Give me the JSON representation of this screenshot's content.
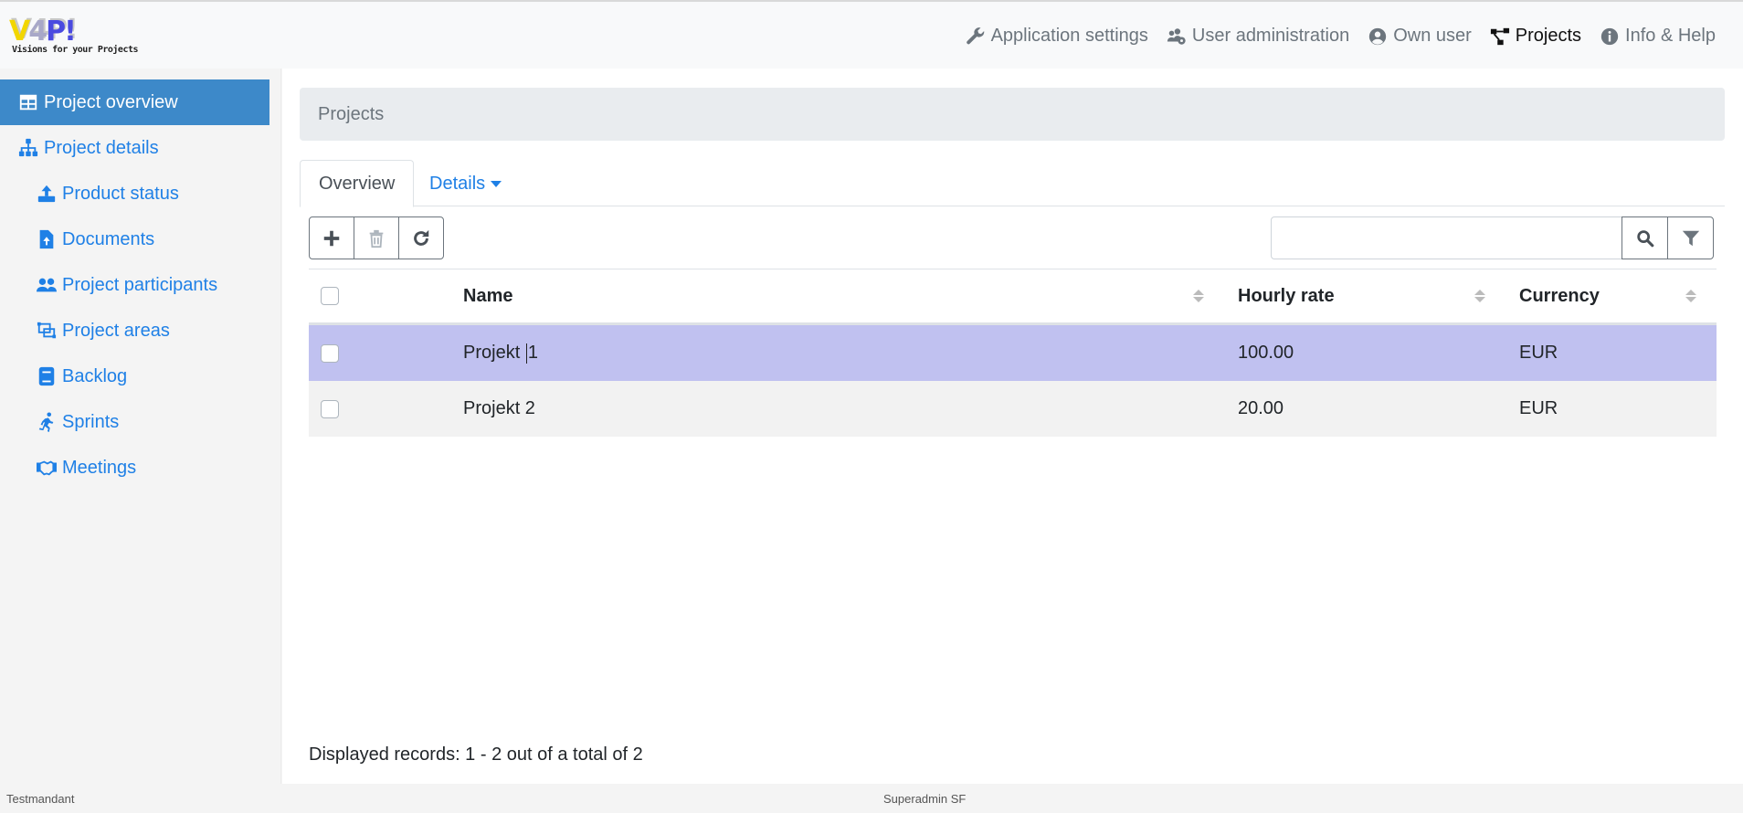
{
  "app": {
    "logo_text": "V4P!",
    "logo_parts": [
      "V",
      "4",
      "P!"
    ],
    "logo_tagline": "Visions for your Projects"
  },
  "topnav": [
    {
      "label": "Application settings",
      "icon": "wrench-icon",
      "active": false
    },
    {
      "label": "User administration",
      "icon": "users-cog-icon",
      "active": false
    },
    {
      "label": "Own user",
      "icon": "user-circle-icon",
      "active": false
    },
    {
      "label": "Projects",
      "icon": "project-diagram-icon",
      "active": true
    },
    {
      "label": "Info & Help",
      "icon": "info-circle-icon",
      "active": false
    }
  ],
  "sidebar": {
    "items": [
      {
        "label": "Project overview",
        "icon": "table-icon",
        "active": true
      },
      {
        "label": "Project details",
        "icon": "sitemap-icon",
        "active": false
      },
      {
        "label": "Product status",
        "icon": "upload-icon",
        "active": false
      },
      {
        "label": "Documents",
        "icon": "file-upload-icon",
        "active": false
      },
      {
        "label": "Project participants",
        "icon": "users-icon",
        "active": false
      },
      {
        "label": "Project areas",
        "icon": "object-group-icon",
        "active": false
      },
      {
        "label": "Backlog",
        "icon": "book-icon",
        "active": false
      },
      {
        "label": "Sprints",
        "icon": "running-icon",
        "active": false
      },
      {
        "label": "Meetings",
        "icon": "handshake-icon",
        "active": false
      }
    ]
  },
  "breadcrumb": {
    "title": "Projects"
  },
  "tabs": {
    "overview": "Overview",
    "details": "Details"
  },
  "toolbar": {
    "add": "add-icon",
    "delete": "trash-icon",
    "refresh": "refresh-icon"
  },
  "search": {
    "value": "",
    "placeholder": ""
  },
  "table": {
    "columns": [
      "Name",
      "Hourly rate",
      "Currency"
    ],
    "rows": [
      {
        "name_before_cursor": "Projekt ",
        "name_after_cursor": "1",
        "name": "Projekt 1",
        "hourly_rate": "100.00",
        "currency": "EUR",
        "selected": true
      },
      {
        "name": "Projekt 2",
        "hourly_rate": "20.00",
        "currency": "EUR",
        "selected": false
      }
    ]
  },
  "records_info": "Displayed records: 1 - 2 out of a total of 2",
  "status": {
    "tenant": "Testmandant",
    "user": "Superadmin SF"
  },
  "colors": {
    "accent": "#1f80e6",
    "sidebar_active": "#3d89c9",
    "row_selected": "#c0c1f0",
    "row_plain": "#f2f2f2"
  }
}
